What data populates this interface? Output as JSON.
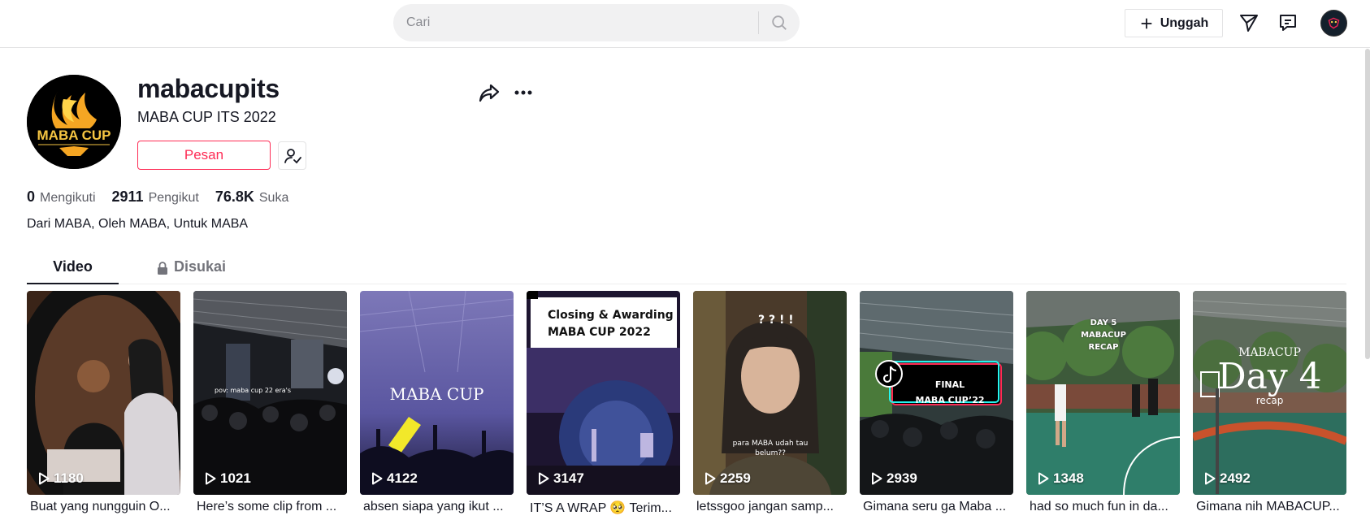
{
  "header": {
    "search_placeholder": "Cari",
    "upload_label": "Unggah",
    "icons": [
      "search-icon",
      "plus-icon",
      "send-icon",
      "inbox-icon",
      "avatar"
    ]
  },
  "profile": {
    "username": "mabacupits",
    "nickname": "MABA CUP ITS 2022",
    "message_label": "Pesan",
    "avatar_logo_text": "MABA CUP",
    "stats": [
      {
        "value": "0",
        "label": "Mengikuti"
      },
      {
        "value": "2911",
        "label": "Pengikut"
      },
      {
        "value": "76.8K",
        "label": "Suka"
      }
    ],
    "bio": "Dari MABA, Oleh MABA, Untuk MABA"
  },
  "tabs": {
    "video": "Video",
    "liked": "Disukai"
  },
  "videos": [
    {
      "views": "1180",
      "caption": "Buat yang nungguin O..."
    },
    {
      "views": "1021",
      "caption": "Here’s some clip from ..."
    },
    {
      "views": "4122",
      "caption": "absen siapa yang ikut ..."
    },
    {
      "views": "3147",
      "caption": "IT’S A WRAP 🥺 Terim..."
    },
    {
      "views": "2259",
      "caption": "letssgoo jangan samp..."
    },
    {
      "views": "2939",
      "caption": "Gimana seru ga Maba ..."
    },
    {
      "views": "1348",
      "caption": "had so much fun in da..."
    },
    {
      "views": "2492",
      "caption": "Gimana nih MABACUP..."
    }
  ],
  "thumb_text": {
    "v2": "pov: maba cup 22 era's",
    "v3": "MABA CUP",
    "v4_line1": "Closing & Awarding",
    "v4_line2": "MABA CUP 2022",
    "v5_q": "? ? ! !",
    "v5_sub": "para MABA udah tau belum??",
    "v6_line1": "FINAL",
    "v6_line2": "MABA CUP’22",
    "v7_line1": "DAY 5",
    "v7_line2": "MABACUP",
    "v7_line3": "RECAP",
    "v8_line1": "MABACUP",
    "v8_line2": "Day 4",
    "v8_line3": "recap"
  },
  "colors": {
    "accent": "#fe2c55",
    "text": "#161823",
    "muted": "#73747b"
  }
}
